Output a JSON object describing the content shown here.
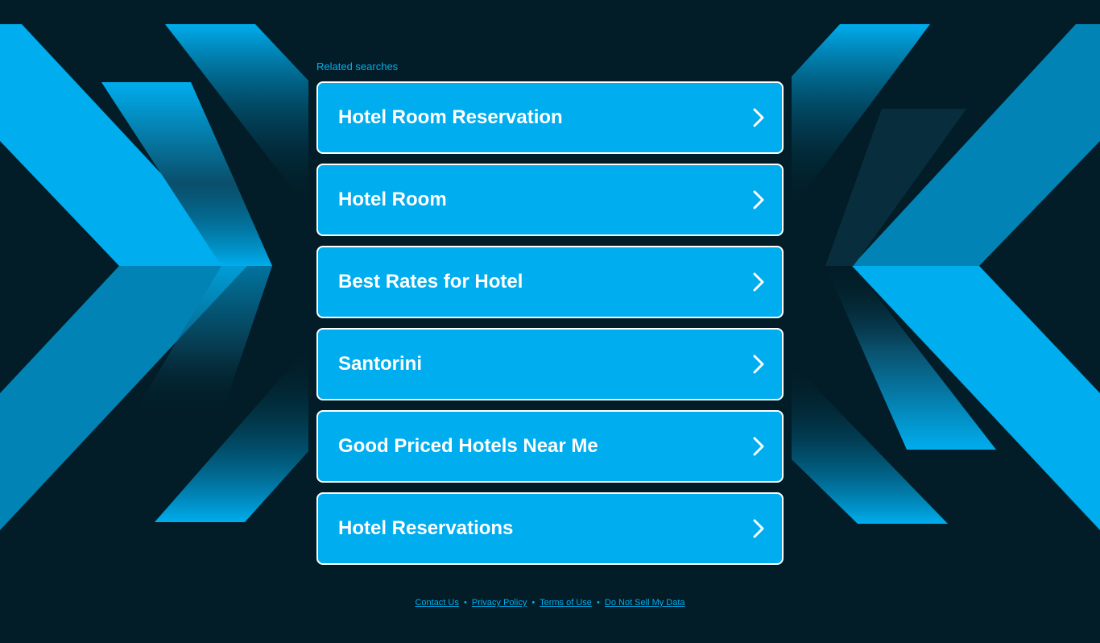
{
  "related_searches": {
    "title": "Related searches",
    "items": [
      {
        "label": "Hotel Room Reservation"
      },
      {
        "label": "Hotel Room"
      },
      {
        "label": "Best Rates for Hotel"
      },
      {
        "label": "Santorini"
      },
      {
        "label": "Good Priced Hotels Near Me"
      },
      {
        "label": "Hotel Reservations"
      }
    ],
    "item_icon": "chevron-right-icon"
  },
  "footer": {
    "links": [
      {
        "label": "Contact Us"
      },
      {
        "label": "Privacy Policy"
      },
      {
        "label": "Terms of Use"
      },
      {
        "label": "Do Not Sell My Data"
      }
    ],
    "separator": "•"
  },
  "colors": {
    "background": "#021d27",
    "accent": "#00adee",
    "accent_dark": "#0184b5",
    "text_on_accent": "#ffffff"
  }
}
